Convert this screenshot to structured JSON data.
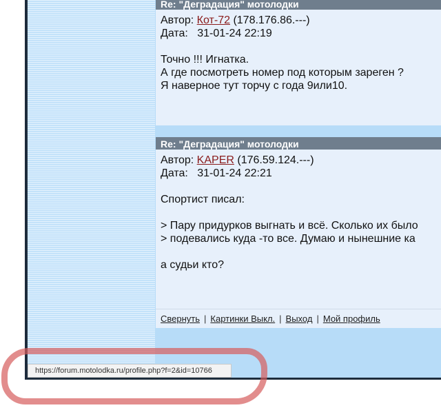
{
  "posts": [
    {
      "title": "Re: \"Деградация\" мотолодки",
      "author_label": "Автор:",
      "author": "Кот-72",
      "ip": "(178.176.86.---)",
      "date_label": "Дата:",
      "date": "31-01-24 22:19",
      "lines": [
        "Точно !!! Игнатка.",
        "А где посмотреть номер под которым зареген ?",
        "Я наверное тут торчу с года 9или10."
      ]
    },
    {
      "title": "Re: \"Деградация\" мотолодки",
      "author_label": "Автор:",
      "author": "KAPER",
      "ip": "(176.59.124.---)",
      "date_label": "Дата:",
      "date": "31-01-24 22:21",
      "lines": [
        "Спортист писал:",
        "",
        "> Пару придурков выгнать и всё. Сколько их было",
        "> подевались куда -то все. Думаю и нынешние ка",
        "",
        "а судьи кто?"
      ]
    }
  ],
  "footer": {
    "collapse": "Свернуть",
    "images_off": "Картинки Выкл.",
    "logout": "Выход",
    "profile": "Мой профиль",
    "separator": "|"
  },
  "statusbar": {
    "url": "https://forum.motolodka.ru/profile.php?f=2&id=10766"
  }
}
